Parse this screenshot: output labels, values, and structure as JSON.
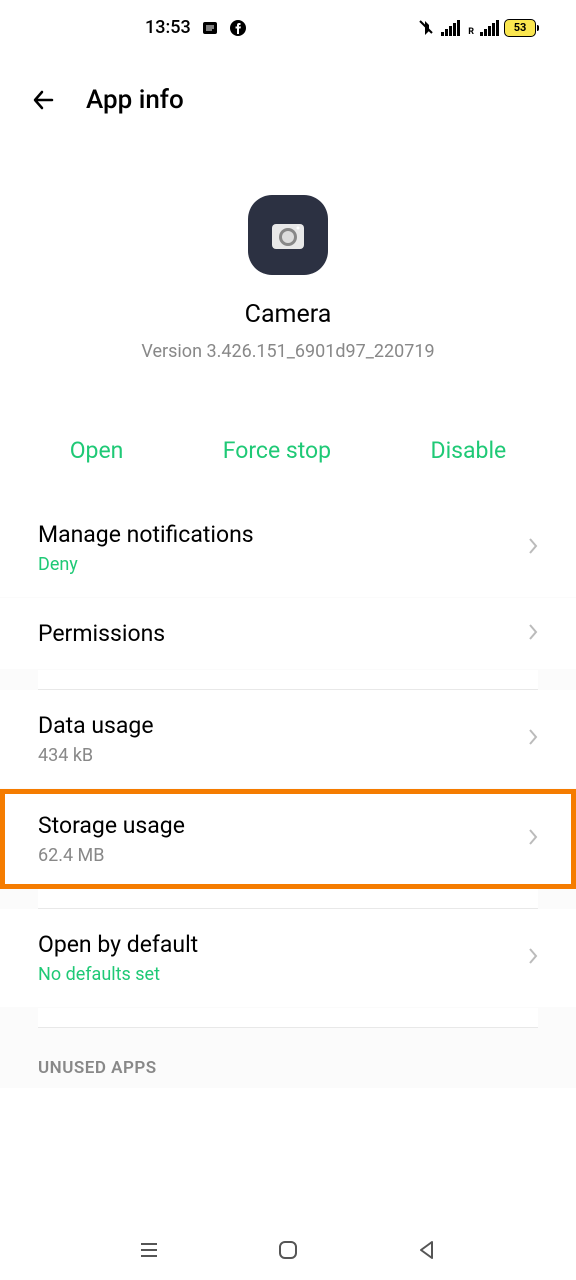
{
  "status": {
    "time": "13:53",
    "battery": "53"
  },
  "header": {
    "title": "App info"
  },
  "app": {
    "name": "Camera",
    "version": "Version 3.426.151_6901d97_220719"
  },
  "actions": {
    "open": "Open",
    "force_stop": "Force stop",
    "disable": "Disable"
  },
  "items": {
    "notifications": {
      "title": "Manage notifications",
      "subtitle": "Deny"
    },
    "permissions": {
      "title": "Permissions"
    },
    "data_usage": {
      "title": "Data usage",
      "subtitle": "434 kB"
    },
    "storage_usage": {
      "title": "Storage usage",
      "subtitle": "62.4 MB"
    },
    "open_default": {
      "title": "Open by default",
      "subtitle": "No defaults set"
    }
  },
  "section": {
    "unused": "UNUSED APPS"
  }
}
